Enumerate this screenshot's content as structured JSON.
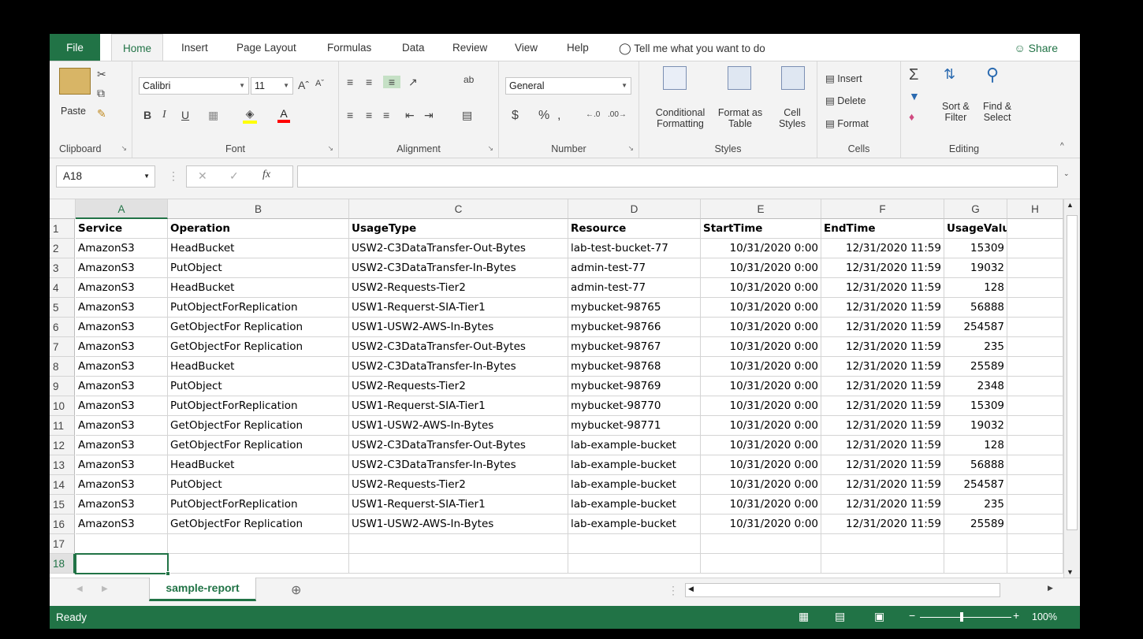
{
  "ribbon_tabs": {
    "file": "File",
    "home": "Home",
    "insert": "Insert",
    "page_layout": "Page Layout",
    "formulas": "Formulas",
    "data": "Data",
    "review": "Review",
    "view": "View",
    "help": "Help",
    "tell_me": "Tell me what you want to do",
    "share": "Share"
  },
  "clipboard": {
    "paste": "Paste",
    "label": "Clipboard"
  },
  "font": {
    "family": "Calibri",
    "size": "11",
    "bold": "B",
    "italic": "I",
    "underline": "U",
    "label": "Font"
  },
  "alignment": {
    "label": "Alignment"
  },
  "number": {
    "format": "General",
    "currency": "$",
    "percent": "%",
    "comma": ",",
    "label": "Number"
  },
  "styles": {
    "conditional_line1": "Conditional",
    "conditional_line2": "Formatting",
    "format_table_line1": "Format as",
    "format_table_line2": "Table",
    "cell_styles_line1": "Cell",
    "cell_styles_line2": "Styles",
    "label": "Styles"
  },
  "cells": {
    "insert": "Insert",
    "delete": "Delete",
    "format": "Format",
    "label": "Cells"
  },
  "editing": {
    "sort_line1": "Sort &",
    "sort_line2": "Filter",
    "find_line1": "Find &",
    "find_line2": "Select",
    "label": "Editing"
  },
  "formula_bar": {
    "name_box": "A18",
    "fx": "fx",
    "formula": ""
  },
  "grid": {
    "columns": [
      "A",
      "B",
      "C",
      "D",
      "E",
      "F",
      "G",
      "H"
    ],
    "rows": [
      [
        "Service",
        "Operation",
        "UsageType",
        "Resource",
        "StartTime",
        "EndTime",
        "UsageValue",
        ""
      ],
      [
        "AmazonS3",
        "HeadBucket",
        "USW2-C3DataTransfer-Out-Bytes",
        "lab-test-bucket-77",
        "10/31/2020 0:00",
        "12/31/2020 11:59",
        "15309",
        ""
      ],
      [
        "AmazonS3",
        "PutObject",
        "USW2-C3DataTransfer-In-Bytes",
        "admin-test-77",
        "10/31/2020 0:00",
        "12/31/2020 11:59",
        "19032",
        ""
      ],
      [
        "AmazonS3",
        "HeadBucket",
        "USW2-Requests-Tier2",
        "admin-test-77",
        "10/31/2020 0:00",
        "12/31/2020 11:59",
        "128",
        ""
      ],
      [
        "AmazonS3",
        "PutObjectForReplication",
        "USW1-Requerst-SIA-Tier1",
        "mybucket-98765",
        "10/31/2020 0:00",
        "12/31/2020 11:59",
        "56888",
        ""
      ],
      [
        "AmazonS3",
        "GetObjectFor Replication",
        "USW1-USW2-AWS-In-Bytes",
        "mybucket-98766",
        "10/31/2020 0:00",
        "12/31/2020 11:59",
        "254587",
        ""
      ],
      [
        "AmazonS3",
        "GetObjectFor Replication",
        "USW2-C3DataTransfer-Out-Bytes",
        "mybucket-98767",
        "10/31/2020 0:00",
        "12/31/2020 11:59",
        "235",
        ""
      ],
      [
        "AmazonS3",
        "HeadBucket",
        "USW2-C3DataTransfer-In-Bytes",
        "mybucket-98768",
        "10/31/2020 0:00",
        "12/31/2020 11:59",
        "25589",
        ""
      ],
      [
        "AmazonS3",
        "PutObject",
        "USW2-Requests-Tier2",
        "mybucket-98769",
        "10/31/2020 0:00",
        "12/31/2020 11:59",
        "2348",
        ""
      ],
      [
        "AmazonS3",
        "PutObjectForReplication",
        "USW1-Requerst-SIA-Tier1",
        "mybucket-98770",
        "10/31/2020 0:00",
        "12/31/2020 11:59",
        "15309",
        ""
      ],
      [
        "AmazonS3",
        "GetObjectFor Replication",
        "USW1-USW2-AWS-In-Bytes",
        "mybucket-98771",
        "10/31/2020 0:00",
        "12/31/2020 11:59",
        "19032",
        ""
      ],
      [
        "AmazonS3",
        "GetObjectFor Replication",
        "USW2-C3DataTransfer-Out-Bytes",
        "lab-example-bucket",
        "10/31/2020 0:00",
        "12/31/2020 11:59",
        "128",
        ""
      ],
      [
        "AmazonS3",
        "HeadBucket",
        "USW2-C3DataTransfer-In-Bytes",
        "lab-example-bucket",
        "10/31/2020 0:00",
        "12/31/2020 11:59",
        "56888",
        ""
      ],
      [
        "AmazonS3",
        "PutObject",
        "USW2-Requests-Tier2",
        "lab-example-bucket",
        "10/31/2020 0:00",
        "12/31/2020 11:59",
        "254587",
        ""
      ],
      [
        "AmazonS3",
        "PutObjectForReplication",
        "USW1-Requerst-SIA-Tier1",
        "lab-example-bucket",
        "10/31/2020 0:00",
        "12/31/2020 11:59",
        "235",
        ""
      ],
      [
        "AmazonS3",
        "GetObjectFor Replication",
        "USW1-USW2-AWS-In-Bytes",
        "lab-example-bucket",
        "10/31/2020 0:00",
        "12/31/2020 11:59",
        "25589",
        ""
      ],
      [
        "",
        "",
        "",
        "",
        "",
        "",
        "",
        ""
      ],
      [
        "",
        "",
        "",
        "",
        "",
        "",
        "",
        ""
      ]
    ],
    "selected_cell": "A18"
  },
  "sheet_tabs": {
    "active": "sample-report"
  },
  "status": {
    "text": "Ready",
    "zoom": "100%"
  },
  "colors": {
    "accent": "#217346"
  }
}
